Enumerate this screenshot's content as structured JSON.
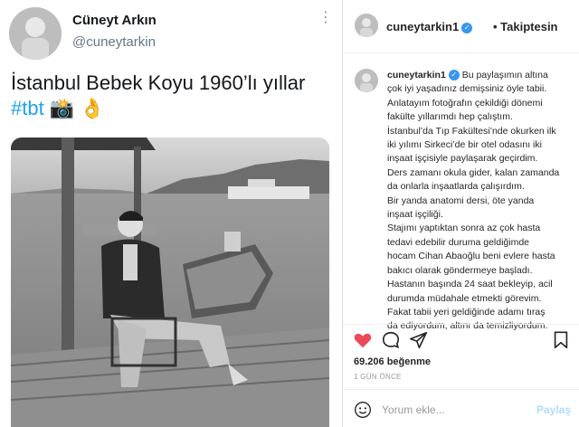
{
  "tweet": {
    "name": "Cüneyt Arkın",
    "handle": "@cuneytarkin",
    "more_icon": "⋮",
    "text": "İstanbul Bebek Koyu 1960’lı yıllar",
    "hashtag": "#tbt",
    "emoji_camera": "📸",
    "emoji_ok": "👌",
    "link_color": "#1da1f2"
  },
  "instagram": {
    "username": "cuneytarkin1",
    "verified_icon": "✓",
    "follow_status": "• Takiptesin",
    "caption_user": "cuneytarkin1",
    "caption_lines": [
      "Bu paylaşımın altına",
      "çok iyi yaşadınız demişsiniz öyle tabii.",
      "Anlatayım fotoğrafın çekildiği dönemi",
      "fakülte yıllarımdı hep çalıştım.",
      "İstanbul’da Tıp Fakültesi’nde okurken ilk",
      "iki yılımı Sirkeci’de bir otel odasını iki",
      "inşaat işçisiyle paylaşarak geçirdim.",
      "Ders zamanı okula gider, kalan zamanda",
      "da onlarla inşaatlarda çalışırdım.",
      "Bir yanda anatomi dersi, öte yanda",
      "inşaat işçiliği.",
      "Stajımı yaptıktan sonra az çok hasta",
      "tedavi edebilir duruma geldiğimde",
      "hocam Cihan Abaoğlu beni evlere hasta",
      "bakıcı olarak göndermeye başladı.",
      "Hastanın başında 24 saat bekleyip, acil",
      "durumda müdahale etmekti görevim.",
      "Fakat tabii yeri geldiğinde adamı tıraş",
      "da ediyordum, altını da temizliyordum."
    ],
    "likes": "69.206 beğenme",
    "time": "1 GÜN ÖNCE",
    "comment_placeholder": "Yorum ekle...",
    "post_label": "Paylaş",
    "like_color": "#ed4956",
    "post_color": "#b3dbff"
  }
}
